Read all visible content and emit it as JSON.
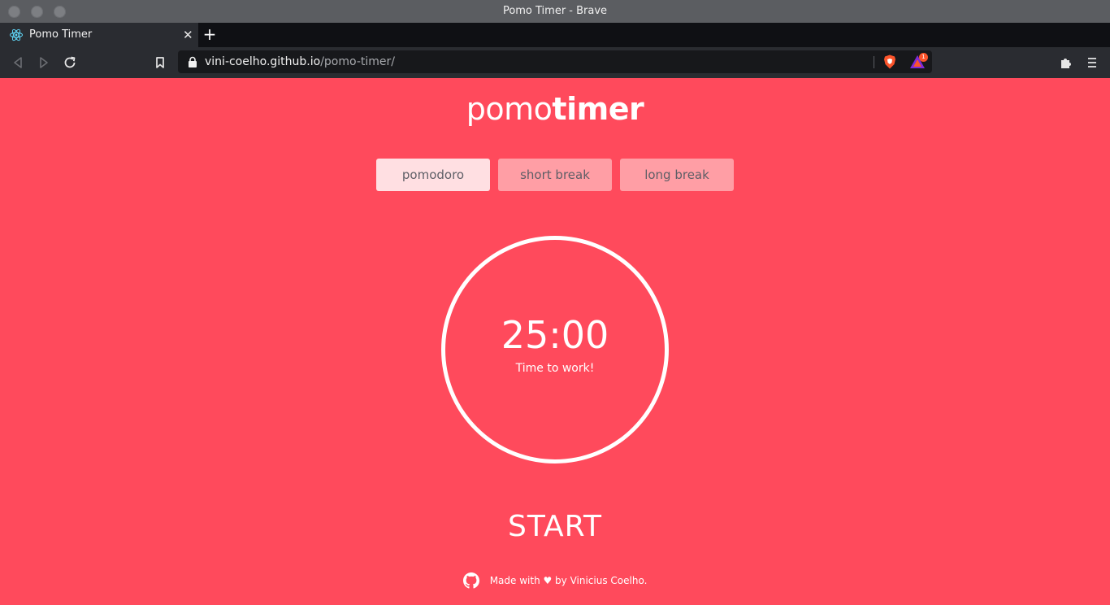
{
  "window": {
    "title": "Pomo Timer - Brave"
  },
  "tab": {
    "title": "Pomo Timer",
    "close": "✕",
    "new_tab": "+"
  },
  "address_bar": {
    "host": "vini-coelho.github.io",
    "path": "/pomo-timer/",
    "rewards_badge": "1"
  },
  "colors": {
    "background": "#ff4a5c",
    "active_mode": "#ffdfe2",
    "inactive_mode": "#ff9ea5"
  },
  "page": {
    "logo_light": "pomo",
    "logo_bold": "timer",
    "modes": [
      {
        "label": "pomodoro",
        "active": true
      },
      {
        "label": "short break",
        "active": false
      },
      {
        "label": "long break",
        "active": false
      }
    ],
    "timer": {
      "time": "25:00",
      "message": "Time to work!"
    },
    "start_label": "START",
    "footer": {
      "text": "Made with ♥ by Vinicius Coelho.",
      "icon": "github-icon"
    }
  }
}
